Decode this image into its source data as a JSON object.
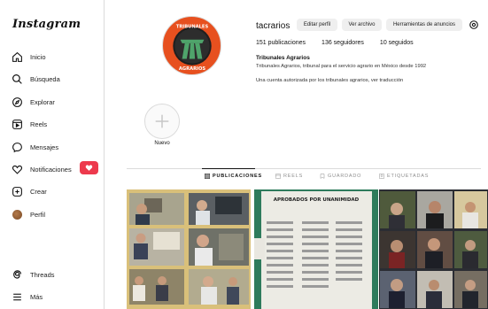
{
  "sidebar": {
    "logo": "Instagram",
    "items": [
      {
        "label": "Inicio",
        "icon": "home-icon"
      },
      {
        "label": "Búsqueda",
        "icon": "search-icon"
      },
      {
        "label": "Explorar",
        "icon": "compass-icon"
      },
      {
        "label": "Reels",
        "icon": "reels-icon"
      },
      {
        "label": "Mensajes",
        "icon": "messenger-icon"
      },
      {
        "label": "Notificaciones",
        "icon": "heart-icon"
      },
      {
        "label": "Crear",
        "icon": "plus-square-icon"
      },
      {
        "label": "Perfil",
        "icon": "avatar"
      },
      {
        "label": "Threads",
        "icon": "threads-icon"
      },
      {
        "label": "Más",
        "icon": "menu-icon"
      }
    ]
  },
  "profile": {
    "username": "tacrarios",
    "buttons": {
      "edit": "Editar perfil",
      "archive": "Ver archivo",
      "ads": "Herramientas de anuncios"
    },
    "stats": {
      "posts": "151 publicaciones",
      "followers": "136 seguidores",
      "following": "10 seguidos"
    },
    "full_name": "Tribunales Agrarios",
    "bio_line_1": "Tribunales Agrarios, tribunal para el servicio agrario en México desde 1992",
    "bio_line_2": "Una cuenta autorizada por los tribunales agrarios, ver traducción"
  },
  "highlights": [
    {
      "label": "Nuevo"
    }
  ],
  "tabs": [
    {
      "label": "PUBLICACIONES",
      "icon": "grid-icon"
    },
    {
      "label": "REELS",
      "icon": "reels-icon"
    },
    {
      "label": "GUARDADO",
      "icon": "bookmark-icon"
    },
    {
      "label": "ETIQUETADAS",
      "icon": "tag-icon"
    }
  ],
  "posts": [
    {
      "label": "post-1"
    },
    {
      "title": "APROBADOS POR UNANIMIDAD"
    },
    {
      "label": "post-3"
    }
  ],
  "colors": {
    "badge": "#ed3a4d",
    "logo_bg": "#e7501f",
    "doc_bg": "#2e7b5c"
  }
}
